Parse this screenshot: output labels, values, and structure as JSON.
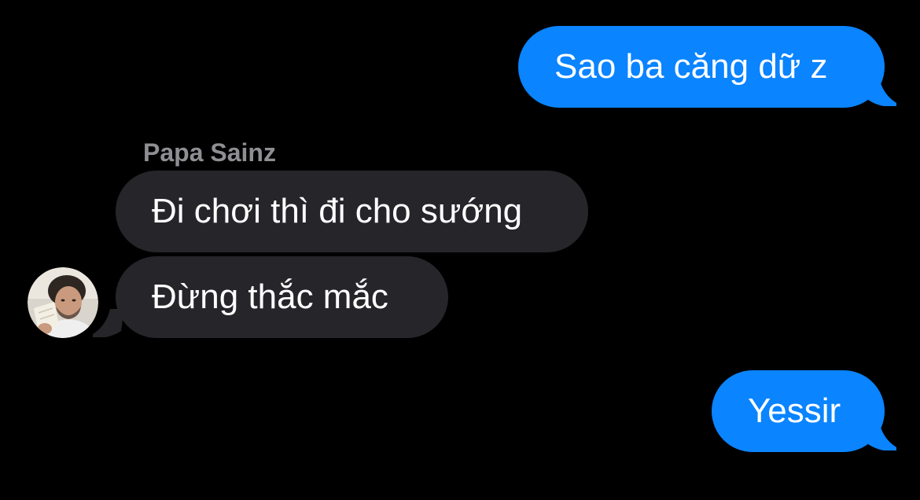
{
  "thread": {
    "outgoing_1": "Sao ba căng dữ z",
    "sender_name": "Papa Sainz",
    "incoming_1": "Đi chơi thì đi cho sướng",
    "incoming_2": "Đừng thắc mắc",
    "outgoing_2": "Yessir"
  },
  "colors": {
    "background": "#000000",
    "outgoing_bubble": "#0a84ff",
    "incoming_bubble": "#26252a",
    "sender_name": "#8e8e93",
    "text": "#ffffff"
  },
  "avatar": {
    "icon": "contact-photo-icon"
  }
}
